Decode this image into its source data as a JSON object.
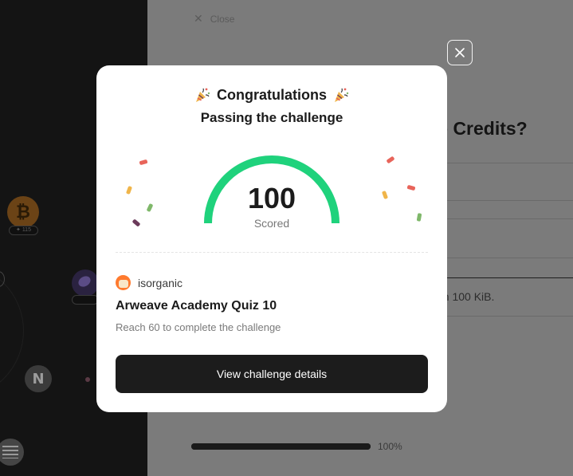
{
  "background": {
    "close_label": "Close",
    "heading_fragment": "o Credits?",
    "body_fragment": "an 100 KiB.",
    "progress": {
      "percent": 100,
      "label": "100%"
    },
    "coin_badge_btc": "115"
  },
  "modal": {
    "title": "Congratulations",
    "subtitle": "Passing the challenge",
    "score": {
      "value": "100",
      "caption": "Scored",
      "fraction": 1.0,
      "color": "#1fd27c",
      "track_color": "#eaeaea"
    },
    "author": {
      "name": "isorganic"
    },
    "quiz_title": "Arweave Academy Quiz 10",
    "quiz_description": "Reach 60 to complete the challenge",
    "primary_button": "View challenge details",
    "icons": {
      "title_decoration": "party-popper-icon",
      "close": "close-icon"
    }
  },
  "colors": {
    "accent_green": "#1fd27c",
    "button_dark": "#1c1c1c",
    "confetti": [
      "#e8645a",
      "#f0b54a",
      "#7fb86a",
      "#6b3a5a"
    ]
  }
}
